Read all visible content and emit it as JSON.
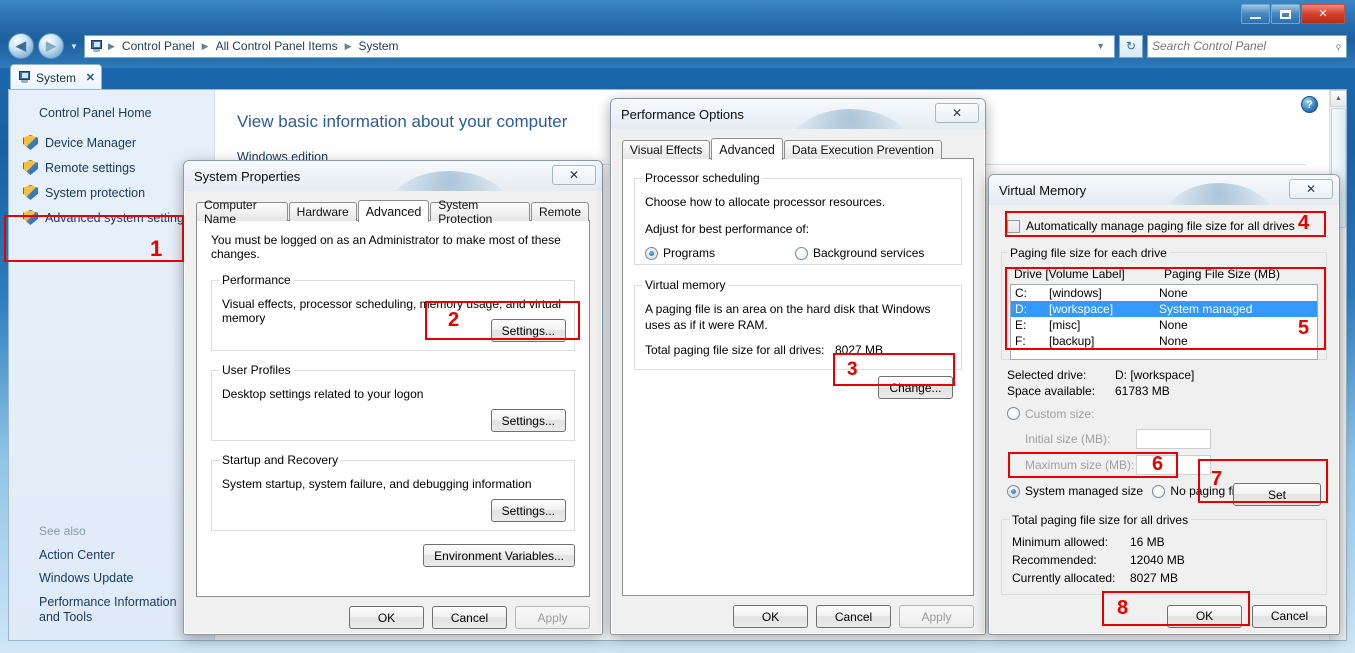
{
  "window": {
    "minimize_label": "Minimize",
    "maximize_label": "Maximize",
    "close_label": "✕"
  },
  "address_bar": {
    "back_label": "◀",
    "forward_label": "▶",
    "history_caret": "▼",
    "breadcrumb": [
      "Control Panel",
      "All Control Panel Items",
      "System"
    ],
    "breadcrumb_separator": "▶",
    "dropdown_caret": "▼",
    "refresh_label": "↻",
    "search_placeholder": "Search Control Panel",
    "search_value": "",
    "search_icon": "⌕"
  },
  "tab": {
    "label": "System",
    "close_label": "✕"
  },
  "sidebar": {
    "home_label": "Control Panel Home",
    "items": [
      {
        "label": "Device Manager"
      },
      {
        "label": "Remote settings"
      },
      {
        "label": "System protection"
      },
      {
        "label": "Advanced system settings"
      }
    ],
    "see_also_title": "See also",
    "see_also": [
      {
        "label": "Action Center"
      },
      {
        "label": "Windows Update"
      },
      {
        "label": "Performance Information and Tools"
      }
    ]
  },
  "main": {
    "title": "View basic information about your computer",
    "section": "Windows edition",
    "help_label": "?",
    "scroll_up": "▲"
  },
  "system_properties": {
    "title": "System Properties",
    "close_label": "✕",
    "tabs": [
      {
        "label": "Computer Name",
        "active": false
      },
      {
        "label": "Hardware",
        "active": false
      },
      {
        "label": "Advanced",
        "active": true
      },
      {
        "label": "System Protection",
        "active": false
      },
      {
        "label": "Remote",
        "active": false
      }
    ],
    "notice": "You must be logged on as an Administrator to make most of these changes.",
    "performance": {
      "legend": "Performance",
      "description": "Visual effects, processor scheduling, memory usage, and virtual memory",
      "settings_label": "Settings..."
    },
    "user_profiles": {
      "legend": "User Profiles",
      "description": "Desktop settings related to your logon",
      "settings_label": "Settings..."
    },
    "startup_recovery": {
      "legend": "Startup and Recovery",
      "description": "System startup, system failure, and debugging information",
      "settings_label": "Settings..."
    },
    "environment_label": "Environment Variables...",
    "ok_label": "OK",
    "cancel_label": "Cancel",
    "apply_label": "Apply"
  },
  "performance_options": {
    "title": "Performance Options",
    "close_label": "✕",
    "tabs": [
      {
        "label": "Visual Effects",
        "active": false
      },
      {
        "label": "Advanced",
        "active": true
      },
      {
        "label": "Data Execution Prevention",
        "active": false
      }
    ],
    "processor_scheduling": {
      "legend": "Processor scheduling",
      "description": "Choose how to allocate processor resources.",
      "prompt": "Adjust for best performance of:",
      "option_programs": "Programs",
      "option_background": "Background services",
      "selected": "Programs"
    },
    "virtual_memory": {
      "legend": "Virtual memory",
      "description": "A paging file is an area on the hard disk that Windows uses as if it were RAM.",
      "total_label": "Total paging file size for all drives:",
      "total_value": "8027 MB",
      "change_label": "Change..."
    },
    "ok_label": "OK",
    "cancel_label": "Cancel",
    "apply_label": "Apply"
  },
  "virtual_memory": {
    "title": "Virtual Memory",
    "close_label": "✕",
    "auto_manage_label": "Automatically manage paging file size for all drives",
    "auto_manage_checked": false,
    "drives": {
      "legend": "Paging file size for each drive",
      "headers": {
        "drive": "Drive  [Volume Label]",
        "size": "Paging File Size (MB)"
      },
      "rows": [
        {
          "drive": "C:",
          "volume": "[windows]",
          "size": "None",
          "selected": false
        },
        {
          "drive": "D:",
          "volume": "[workspace]",
          "size": "System managed",
          "selected": true
        },
        {
          "drive": "E:",
          "volume": "[misc]",
          "size": "None",
          "selected": false
        },
        {
          "drive": "F:",
          "volume": "[backup]",
          "size": "None",
          "selected": false
        }
      ]
    },
    "selected_drive_label": "Selected drive:",
    "selected_drive_value": "D:  [workspace]",
    "space_available_label": "Space available:",
    "space_available_value": "61783 MB",
    "custom_size_label": "Custom size:",
    "initial_size_label": "Initial size (MB):",
    "initial_size_value": "",
    "maximum_size_label": "Maximum size (MB):",
    "maximum_size_value": "",
    "system_managed_label": "System managed size",
    "no_paging_label": "No paging file",
    "selected_option": "System managed size",
    "set_label": "Set",
    "totals": {
      "legend": "Total paging file size for all drives",
      "minimum_label": "Minimum allowed:",
      "minimum_value": "16 MB",
      "recommended_label": "Recommended:",
      "recommended_value": "12040 MB",
      "allocated_label": "Currently allocated:",
      "allocated_value": "8027 MB"
    },
    "ok_label": "OK",
    "cancel_label": "Cancel"
  },
  "annotations": {
    "color": "#e60000",
    "steps": [
      {
        "num": "1"
      },
      {
        "num": "2"
      },
      {
        "num": "3"
      },
      {
        "num": "4"
      },
      {
        "num": "5"
      },
      {
        "num": "6"
      },
      {
        "num": "7"
      },
      {
        "num": "8"
      }
    ]
  }
}
